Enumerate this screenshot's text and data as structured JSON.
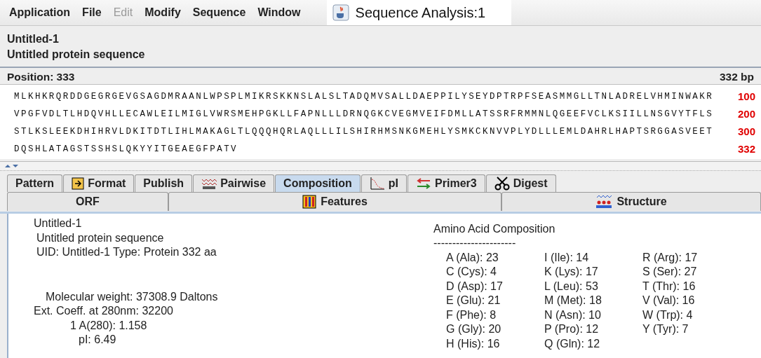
{
  "menu": [
    {
      "label": "Application",
      "disabled": false
    },
    {
      "label": "File",
      "disabled": false
    },
    {
      "label": "Edit",
      "disabled": true
    },
    {
      "label": "Modify",
      "disabled": false
    },
    {
      "label": "Sequence",
      "disabled": false
    },
    {
      "label": "Window",
      "disabled": false
    }
  ],
  "window": {
    "title": "Sequence Analysis:1"
  },
  "header": {
    "name": "Untitled-1",
    "description": "Untitled protein sequence"
  },
  "position_bar": {
    "position": "Position: 333",
    "length": "332 bp"
  },
  "sequence": [
    {
      "residues": "MLKHKRQRDDGEGRGEVGSAGDMRAANLWPSPLMIKRSKKNSLALSLTADQMVSALLDAEPPILYSEYDPTRPFSEASMMGLLTNLADRELVHMINWAKR",
      "end": "100"
    },
    {
      "residues": "VPGFVDLTLHDQVHLLECAWLEILMIGLVWRSMEHPGKLLFAPNLLLDRNQGKCVEGMVEIFDMLLATSSRFRMMNLQGEEFVCLKSIILLNSGVYTFLS",
      "end": "200"
    },
    {
      "residues": "STLKSLEEKDHIHRVLDKITDTLIHLMAKAGLTLQQQHQRLAQLLLILSHIRHMSNKGMEHLYSMKCKNVVPLYDLLLEMLDAHRLHAPTSRGGASVEET",
      "end": "300"
    },
    {
      "residues": "DQSHLATAGSTSSHSLQKYYITGEAEGFPATV",
      "end": "332"
    }
  ],
  "tabs": [
    {
      "label": "Pattern",
      "selected": false
    },
    {
      "label": "Format",
      "selected": false
    },
    {
      "label": "Publish",
      "selected": false
    },
    {
      "label": "Pairwise",
      "selected": false
    },
    {
      "label": "Composition",
      "selected": true
    },
    {
      "label": "pI",
      "selected": false
    },
    {
      "label": "Primer3",
      "selected": false
    },
    {
      "label": "Digest",
      "selected": false
    }
  ],
  "tabs_row2": [
    {
      "label": "ORF",
      "selected": false
    },
    {
      "label": "Features",
      "selected": false
    },
    {
      "label": "Structure",
      "selected": false
    }
  ],
  "summary": {
    "name": "Untitled-1",
    "description": "Untitled protein sequence",
    "uid_line": "UID: Untitled-1  Type: Protein 332 aa",
    "molecular_weight": "Molecular weight: 37308.9 Daltons",
    "ext_coeff": "Ext. Coeff. at 280nm: 32200",
    "a280": "1 A(280): 1.158",
    "pi": "pI: 6.49"
  },
  "composition": {
    "title": "Amino Acid Composition",
    "rule": "----------------------",
    "columns": [
      [
        "A (Ala): 23",
        "C (Cys): 4",
        "D (Asp): 17",
        "E (Glu): 21",
        "F (Phe): 8",
        "G (Gly): 20",
        "H (His): 16"
      ],
      [
        "I (Ile): 14",
        "K (Lys): 17",
        "L (Leu): 53",
        "M (Met): 18",
        "N (Asn): 10",
        "P (Pro): 12",
        "Q (Gln): 12"
      ],
      [
        "R (Arg): 17",
        "S (Ser): 27",
        "T (Thr): 16",
        "V (Val): 16",
        "W (Trp): 4",
        "Y (Tyr): 7"
      ]
    ]
  }
}
